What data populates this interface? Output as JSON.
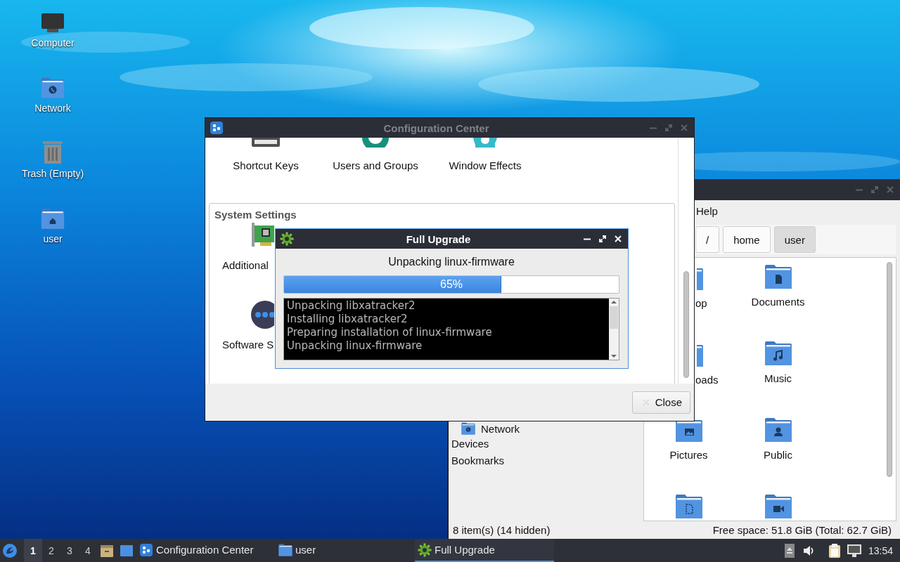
{
  "desktop": {
    "icons": [
      {
        "label": "Computer",
        "kind": "computer"
      },
      {
        "label": "Network",
        "kind": "network"
      },
      {
        "label": "Trash (Empty)",
        "kind": "trash"
      },
      {
        "label": "user",
        "kind": "home"
      }
    ]
  },
  "file_manager": {
    "active": false,
    "menu": [
      "Help"
    ],
    "path": [
      {
        "label": "/",
        "selected": false
      },
      {
        "label": "home",
        "selected": false
      },
      {
        "label": "user",
        "selected": true
      }
    ],
    "sidebar": [
      {
        "label": "Network",
        "kind": "place"
      },
      {
        "label": "Devices",
        "kind": "header"
      },
      {
        "label": "Bookmarks",
        "kind": "header"
      }
    ],
    "items": [
      {
        "label": "op",
        "cut": true
      },
      {
        "label": "Documents",
        "kind": "documents",
        "cut": false
      },
      {
        "label": "oads",
        "cut": true
      },
      {
        "label": "Music",
        "kind": "music",
        "cut": false
      },
      {
        "label": "Pictures",
        "kind": "pictures",
        "cut": false
      },
      {
        "label": "Public",
        "kind": "public",
        "cut": false
      },
      {
        "kind": "templates"
      },
      {
        "kind": "videos"
      }
    ],
    "status": {
      "items": "8 item(s) (14 hidden)",
      "free_space": "Free space: 51.8 GiB (Total: 62.7 GiB)"
    }
  },
  "config_center": {
    "title": "Configuration Center",
    "active": false,
    "top_items": [
      {
        "label": "Shortcut Keys",
        "kind": "keyboard"
      },
      {
        "label": "Users and Groups",
        "kind": "users"
      },
      {
        "label": "Window Effects",
        "kind": "effects"
      }
    ],
    "group": {
      "title": "System Settings",
      "items": [
        {
          "label": "Additional",
          "kind": "card"
        },
        {
          "label": "Software S",
          "kind": "sources"
        }
      ]
    },
    "buttons": [
      {
        "label": "Close"
      }
    ]
  },
  "dialog": {
    "title": "Full Upgrade",
    "active": true,
    "status": "Unpacking linux-firmware",
    "progress": {
      "level": 0.65,
      "text": "65%"
    },
    "log": [
      "Unpacking libxatracker2",
      "Installing libxatracker2",
      "Preparing installation of linux-firmware",
      "Unpacking linux-firmware"
    ]
  },
  "taskbar": {
    "workspaces": [
      {
        "label": "1",
        "selected": true
      },
      {
        "label": "2",
        "selected": false
      },
      {
        "label": "3",
        "selected": false
      },
      {
        "label": "4",
        "selected": false
      }
    ],
    "tasks": [
      {
        "label": "Configuration Center",
        "kind": "config",
        "selected": false
      },
      {
        "label": "user",
        "kind": "folder",
        "selected": false
      },
      {
        "label": "Full Upgrade",
        "kind": "upgrade",
        "selected": true
      }
    ],
    "clock": "13:54"
  }
}
